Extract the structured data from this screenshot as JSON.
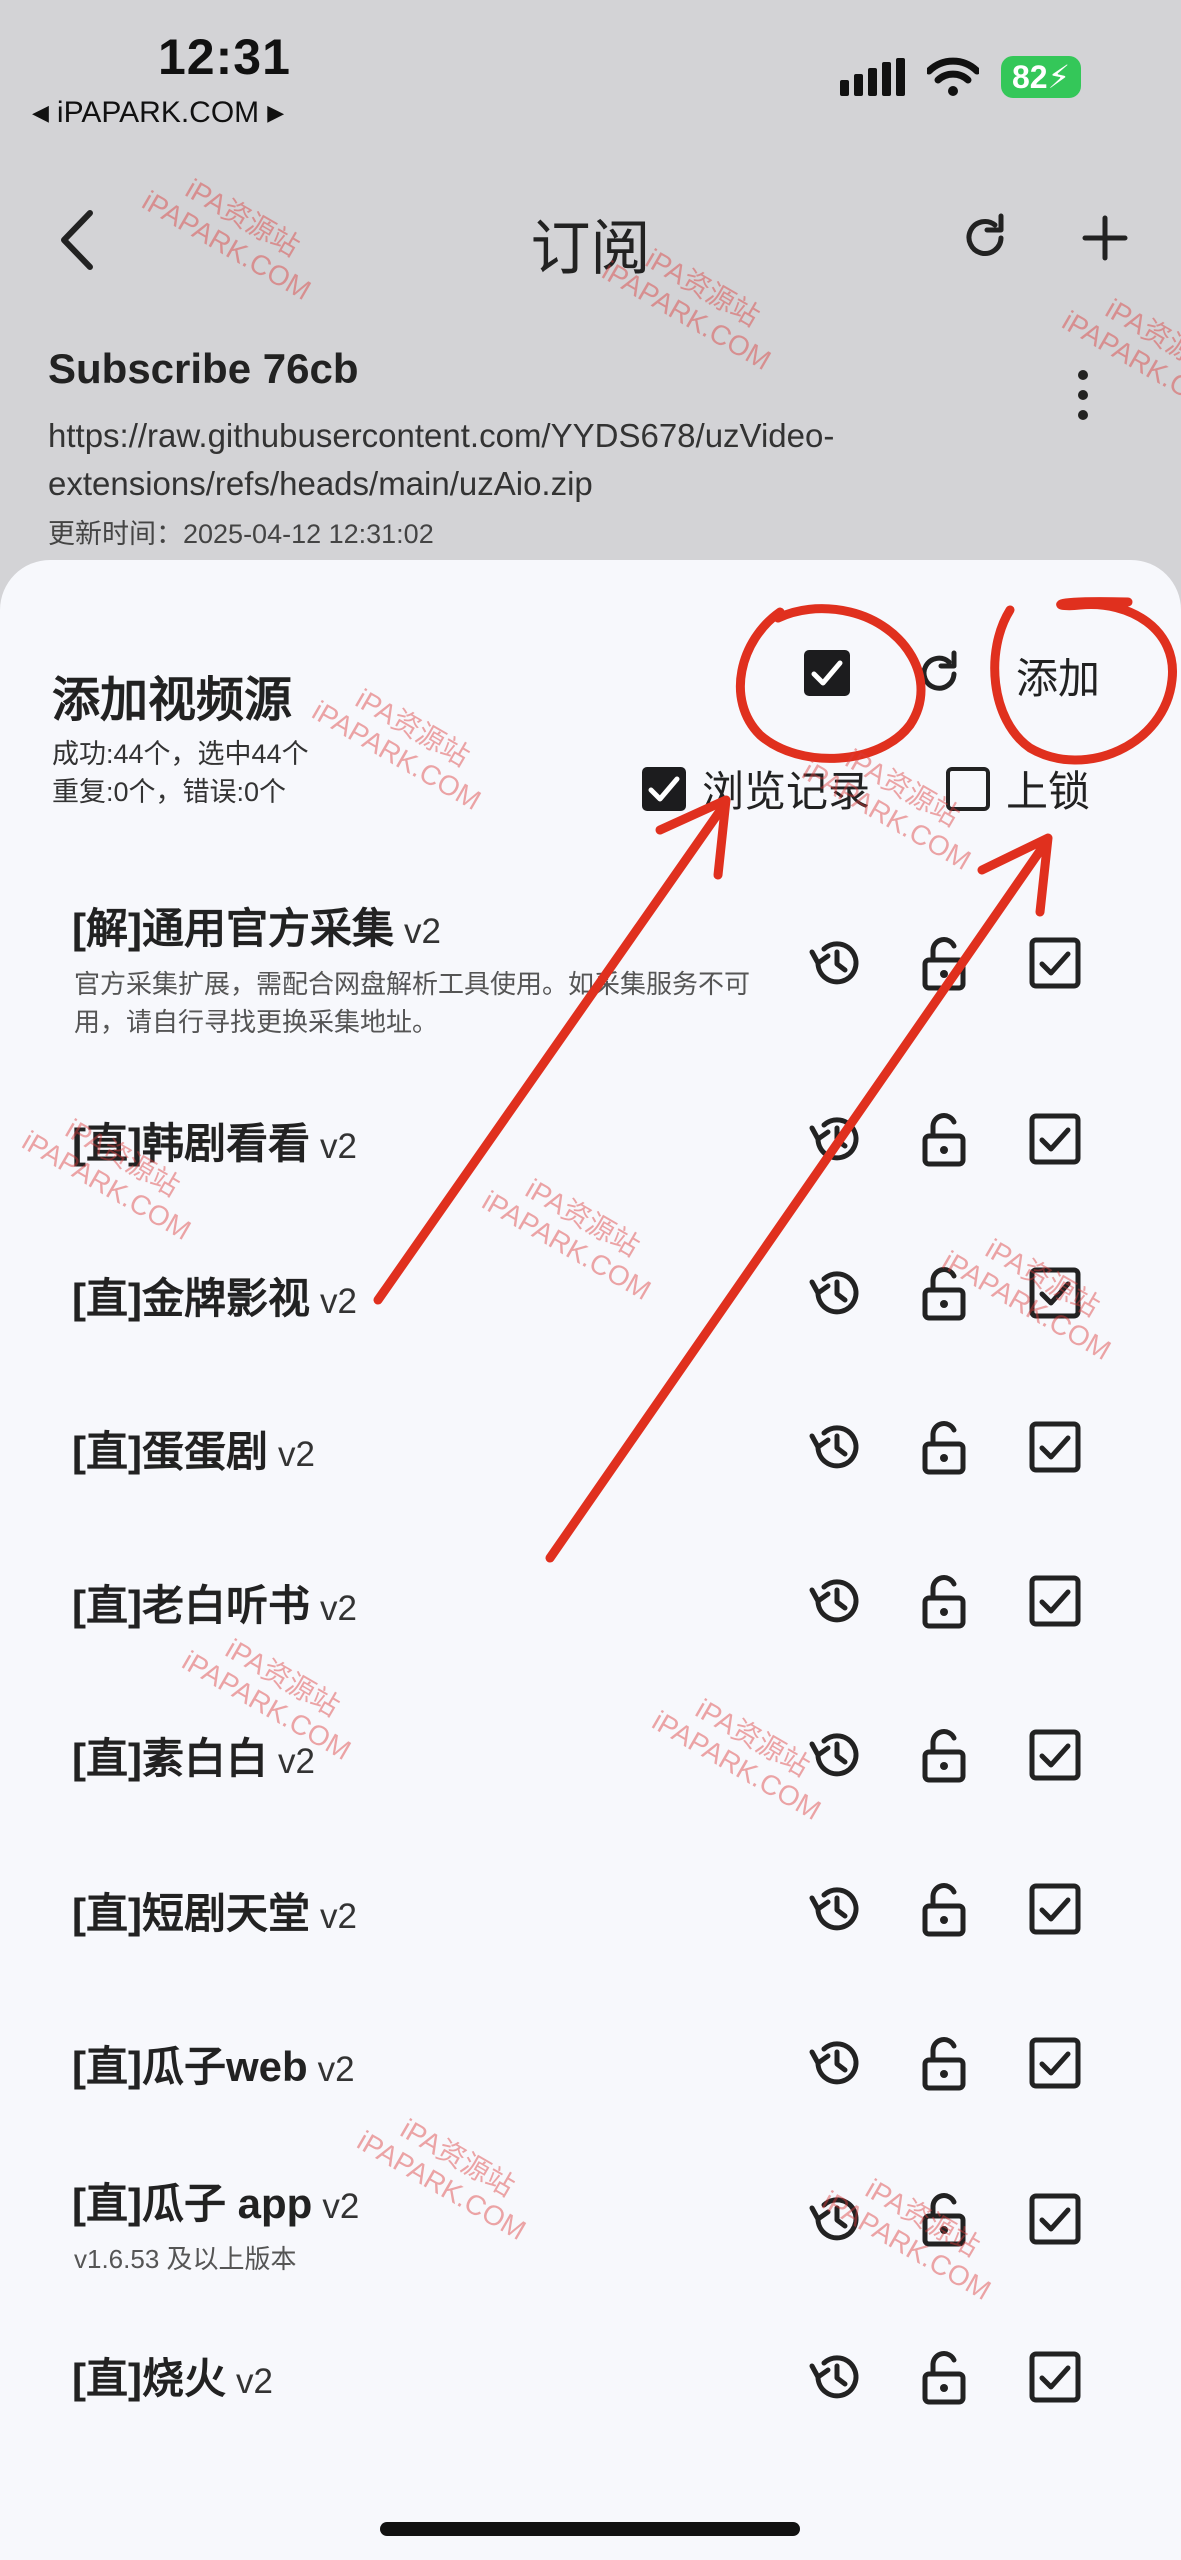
{
  "status_bar": {
    "time": "12:31",
    "back_label": "iPAPARK.COM",
    "battery": "82"
  },
  "appbar": {
    "title": "订阅"
  },
  "subscription": {
    "name": "Subscribe 76cb",
    "url": "https://raw.githubusercontent.com/YYDS678/uzVideo-extensions/refs/heads/main/uzAio.zip",
    "updated": "更新时间：2025-04-12 12:31:02"
  },
  "sheet": {
    "title": "添加视频源",
    "stats_line1": "成功:44个，选中44个",
    "stats_line2": "重复:0个，错误:0个",
    "add_label": "添加",
    "history_label": "浏览记录",
    "lock_label": "上锁"
  },
  "sources": [
    {
      "name": "[解]通用官方采集",
      "version": "v2",
      "desc": "官方采集扩展，需配合网盘解析工具使用。如采集服务不可用，请自行寻找更换采集地址。"
    },
    {
      "name": "[直]韩剧看看",
      "version": "v2",
      "desc": ""
    },
    {
      "name": "[直]金牌影视",
      "version": "v2",
      "desc": ""
    },
    {
      "name": "[直]蛋蛋剧",
      "version": "v2",
      "desc": ""
    },
    {
      "name": "[直]老白听书",
      "version": "v2",
      "desc": ""
    },
    {
      "name": "[直]素白白",
      "version": "v2",
      "desc": ""
    },
    {
      "name": "[直]短剧天堂",
      "version": "v2",
      "desc": ""
    },
    {
      "name": "[直]瓜子web",
      "version": "v2",
      "desc": ""
    },
    {
      "name": "[直]瓜子 app",
      "version": "v2",
      "desc": "v1.6.53 及以上版本"
    },
    {
      "name": "[直]烧火",
      "version": "v2",
      "desc": ""
    }
  ],
  "watermark": {
    "line1": "iPA资源站",
    "line2": "iPAPARK.COM"
  },
  "colors": {
    "annotation": "#e0301e",
    "battery": "#34c759",
    "sheet_bg": "#f7f8fc",
    "header_bg": "#d3d3d6"
  }
}
